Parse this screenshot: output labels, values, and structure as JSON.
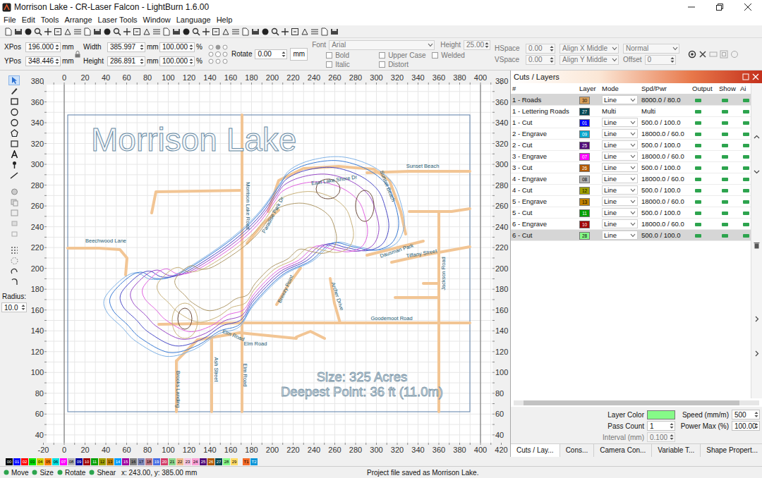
{
  "window": {
    "title": "Morrison Lake - CR-Laser Falcon - LightBurn 1.6.00"
  },
  "menu": [
    "File",
    "Edit",
    "Tools",
    "Arrange",
    "Laser Tools",
    "Window",
    "Language",
    "Help"
  ],
  "position": [
    {
      "label": "XPos",
      "value": "196.000",
      "unit": "mm"
    },
    {
      "label": "YPos",
      "value": "348.446",
      "unit": "mm"
    }
  ],
  "size": [
    {
      "label": "Width",
      "value": "385.997",
      "unit": "mm",
      "percent": "100.000",
      "pct": "%"
    },
    {
      "label": "Height",
      "value": "286.891",
      "unit": "mm",
      "percent": "100.000",
      "pct": "%"
    }
  ],
  "rotate": {
    "label": "Rotate",
    "value": "0.00",
    "unit_button": "mm"
  },
  "text": {
    "disabled": true,
    "font_label": "Font",
    "font": "Arial",
    "height_label": "Height",
    "height": "25.00",
    "options": [
      {
        "label": "Bold",
        "checked": false
      },
      {
        "label": "Upper Case",
        "checked": false
      },
      {
        "label": "Welded",
        "checked": false
      },
      {
        "label": "Italic",
        "checked": false
      },
      {
        "label": "Distort",
        "checked": false
      }
    ],
    "hspace_label": "HSpace",
    "hspace": "0.00",
    "vspace_label": "VSpace",
    "vspace": "0.00",
    "align_x": "Align X Middle",
    "align_y": "Align Y Middle",
    "style": "Normal",
    "offset_label": "Offset",
    "offset": "0"
  },
  "tools": {
    "radius_label": "Radius:",
    "radius": "10.0"
  },
  "rulers": {
    "top": [
      "0",
      "20",
      "40",
      "60",
      "80",
      "100",
      "120",
      "140",
      "160",
      "180",
      "200",
      "220",
      "240",
      "260",
      "280",
      "300",
      "320",
      "340",
      "360",
      "380",
      "400"
    ],
    "left": [
      "380",
      "360",
      "340",
      "320",
      "300",
      "280",
      "260",
      "240",
      "220",
      "200",
      "180",
      "160",
      "140",
      "120",
      "100",
      "80",
      "60",
      "40"
    ],
    "right": [
      "380",
      "360",
      "340",
      "320",
      "300",
      "280",
      "260",
      "240",
      "220",
      "200",
      "180",
      "160",
      "140",
      "120",
      "100",
      "80",
      "60",
      "40"
    ],
    "bottom": [
      "-20",
      "0",
      "20",
      "40",
      "60",
      "80",
      "100",
      "120",
      "140",
      "160",
      "180",
      "200",
      "220",
      "240",
      "260",
      "280",
      "300",
      "320",
      "340",
      "360",
      "380",
      "400",
      "420"
    ]
  },
  "map": {
    "title": "Morrison Lake",
    "streets": [
      "East Lake Shore Dr",
      "Sunset Beach",
      "Sunset Beach",
      "Morrison Lake Road",
      "Paradise Park Dr",
      "Beechwood Lane",
      "Dausman Park",
      "Tiffany Street",
      "Jackson Road",
      "Breezy Point",
      "Archer Drive",
      "Goodemoot Road",
      "Elm Road",
      "Elm Road",
      "Ash Street",
      "Elm Road",
      "Brooks Landing"
    ],
    "info": [
      "Size: 325 Acres",
      "Deepest Point: 36 ft (11.0m)"
    ]
  },
  "layers": {
    "title": "Cuts / Layers",
    "columns": [
      "#",
      "Layer",
      "Mode",
      "Spd/Pwr",
      "Output",
      "Show",
      "Ai"
    ],
    "rows": [
      {
        "name": "1 - Roads",
        "layer": "30",
        "color": "#d9a05b",
        "mode": "Line",
        "kind": "combo",
        "speed_power": "8000.0 / 80.0",
        "output": true,
        "show": true,
        "air": true,
        "selected": true
      },
      {
        "name": "1 - Lettering Roads",
        "layer": "27",
        "color": "#004754",
        "mode": "Multi",
        "kind": "text",
        "speed_power": "Multi",
        "output": true,
        "show": true,
        "air": true,
        "selected": false
      },
      {
        "name": "1 - Cut",
        "layer": "01",
        "color": "#0000ff",
        "mode": "Line",
        "kind": "combo",
        "speed_power": "500.0 / 100.0",
        "output": true,
        "show": true,
        "air": true,
        "selected": false
      },
      {
        "name": "2 - Engrave",
        "layer": "09",
        "color": "#00a8d0",
        "mode": "Line",
        "kind": "combo",
        "speed_power": "18000.0 / 60.0",
        "output": true,
        "show": true,
        "air": true,
        "selected": false
      },
      {
        "name": "2 - Cut",
        "layer": "25",
        "color": "#500a78",
        "mode": "Line",
        "kind": "combo",
        "speed_power": "500.0 / 100.0",
        "output": true,
        "show": true,
        "air": true,
        "selected": false
      },
      {
        "name": "3 - Engrave",
        "layer": "07",
        "color": "#ff00ff",
        "mode": "Line",
        "kind": "combo",
        "speed_power": "18000.0 / 60.0",
        "output": true,
        "show": true,
        "air": true,
        "selected": false
      },
      {
        "name": "3 - Cut",
        "layer": "26",
        "color": "#b45a00",
        "mode": "Line",
        "kind": "combo",
        "speed_power": "500.0 / 100.0",
        "output": true,
        "show": true,
        "air": true,
        "selected": false
      },
      {
        "name": "4 - Engrave",
        "layer": "08",
        "color": "#b4b4b4",
        "mode": "Line",
        "kind": "combo",
        "speed_power": "18000.0 / 60.0",
        "output": true,
        "show": true,
        "air": true,
        "selected": false
      },
      {
        "name": "4 - Cut",
        "layer": "12",
        "color": "#a0a000",
        "mode": "Line",
        "kind": "combo",
        "speed_power": "500.0 / 100.0",
        "output": true,
        "show": true,
        "air": true,
        "selected": false
      },
      {
        "name": "5 - Engrave",
        "layer": "13",
        "color": "#c08000",
        "mode": "Line",
        "kind": "combo",
        "speed_power": "18000.0 / 60.0",
        "output": true,
        "show": true,
        "air": true,
        "selected": false
      },
      {
        "name": "5 - Cut",
        "layer": "11",
        "color": "#00a000",
        "mode": "Line",
        "kind": "combo",
        "speed_power": "500.0 / 100.0",
        "output": true,
        "show": true,
        "air": true,
        "selected": false
      },
      {
        "name": "6 - Engrave",
        "layer": "10",
        "color": "#a00000",
        "mode": "Line",
        "kind": "combo",
        "speed_power": "18000.0 / 60.0",
        "output": true,
        "show": true,
        "air": true,
        "selected": false
      },
      {
        "name": "6 - Cut",
        "layer": "28",
        "color": "#86fa88",
        "mode": "Line",
        "kind": "combo",
        "speed_power": "500.0 / 100.0",
        "output": true,
        "show": true,
        "air": true,
        "selected": true
      }
    ]
  },
  "layer_settings": {
    "color_label": "Layer Color",
    "color": "#86fa88",
    "speed_label": "Speed (mm/m)",
    "speed": "500",
    "pass_label": "Pass Count",
    "pass": "1",
    "power_label": "Power Max (%)",
    "power": "100.00",
    "interval_label": "Interval (mm)",
    "interval": "0.100",
    "interval_disabled": true
  },
  "panel_tabs": [
    {
      "label": "Cuts / Lay...",
      "selected": true
    },
    {
      "label": "Cons...",
      "selected": false
    },
    {
      "label": "Camera Con...",
      "selected": false
    },
    {
      "label": "Variable T...",
      "selected": false
    },
    {
      "label": "Shape Propert...",
      "selected": false
    }
  ],
  "palette": [
    {
      "label": "00",
      "color": "#000000"
    },
    {
      "label": "01",
      "color": "#0000ff"
    },
    {
      "label": "02",
      "color": "#ff0000"
    },
    {
      "label": "03",
      "color": "#00e000"
    },
    {
      "label": "04",
      "color": "#d0d000"
    },
    {
      "label": "05",
      "color": "#ff8000"
    },
    {
      "label": "06",
      "color": "#00e0e0"
    },
    {
      "label": "07",
      "color": "#ff00ff"
    },
    {
      "label": "08",
      "color": "#b4b4b4"
    },
    {
      "label": "09",
      "color": "#0000a0"
    },
    {
      "label": "10",
      "color": "#a00000"
    },
    {
      "label": "11",
      "color": "#00a000"
    },
    {
      "label": "12",
      "color": "#a0a000"
    },
    {
      "label": "13",
      "color": "#c08000"
    },
    {
      "label": "14",
      "color": "#00a0ff"
    },
    {
      "label": "15",
      "color": "#a000a0"
    },
    {
      "label": "16",
      "color": "#808080"
    },
    {
      "label": "17",
      "color": "#7d87b9"
    },
    {
      "label": "18",
      "color": "#bb7784"
    },
    {
      "label": "19",
      "color": "#4a6fe3"
    },
    {
      "label": "20",
      "color": "#d33f6a"
    },
    {
      "label": "21",
      "color": "#8cd78c"
    },
    {
      "label": "22",
      "color": "#f0b98d"
    },
    {
      "label": "23",
      "color": "#f6c4e1"
    },
    {
      "label": "24",
      "color": "#fa9ed4"
    },
    {
      "label": "25",
      "color": "#500a78"
    },
    {
      "label": "26",
      "color": "#b45a00"
    },
    {
      "label": "27",
      "color": "#004754"
    },
    {
      "label": "28",
      "color": "#86fa88"
    },
    {
      "label": "29",
      "color": "#ffdb66"
    },
    {
      "label": "T1",
      "color": "#f36926"
    },
    {
      "label": "T2",
      "color": "#0c96d9"
    }
  ],
  "status": {
    "tools": [
      "Move",
      "Size",
      "Rotate",
      "Shear"
    ],
    "coords": "x: 243.00, y: 385.00 mm",
    "message": "Project file saved as Morrison Lake."
  }
}
